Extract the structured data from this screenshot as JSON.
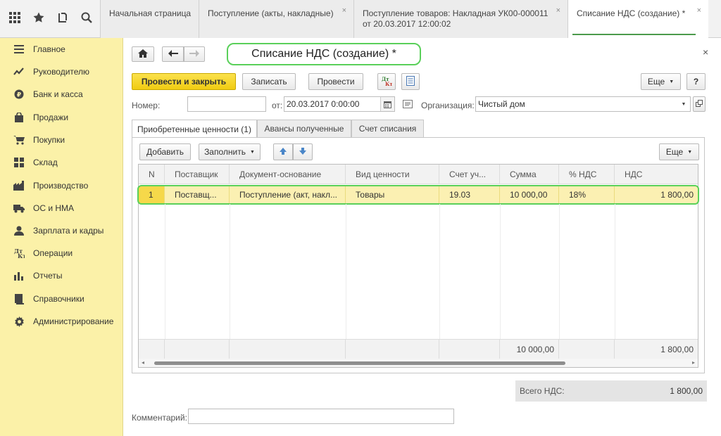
{
  "topbar": {
    "tabs": [
      {
        "label": "Начальная страница",
        "line2": ""
      },
      {
        "label": "Поступление (акты, накладные)",
        "line2": ""
      },
      {
        "label": "Поступление товаров: Накладная УК00-000011",
        "line2": "от 20.03.2017 12:00:02"
      },
      {
        "label": "Списание НДС (создание) *",
        "line2": ""
      }
    ],
    "close_glyph": "×"
  },
  "sidebar": {
    "items": [
      {
        "label": "Главное",
        "icon": "menu-lines-icon"
      },
      {
        "label": "Руководителю",
        "icon": "trend-icon"
      },
      {
        "label": "Банк и касса",
        "icon": "coin-icon"
      },
      {
        "label": "Продажи",
        "icon": "bag-icon"
      },
      {
        "label": "Покупки",
        "icon": "cart-icon"
      },
      {
        "label": "Склад",
        "icon": "warehouse-icon"
      },
      {
        "label": "Производство",
        "icon": "factory-icon"
      },
      {
        "label": "ОС и НМА",
        "icon": "truck-icon"
      },
      {
        "label": "Зарплата и кадры",
        "icon": "person-icon"
      },
      {
        "label": "Операции",
        "icon": "debit-credit-icon"
      },
      {
        "label": "Отчеты",
        "icon": "bar-chart-icon"
      },
      {
        "label": "Справочники",
        "icon": "book-icon"
      },
      {
        "label": "Администрирование",
        "icon": "gear-icon"
      }
    ]
  },
  "form": {
    "title": "Списание НДС (создание) *",
    "close_glyph": "×",
    "toolbar": {
      "post_and_close": "Провести и закрыть",
      "save": "Записать",
      "post": "Провести",
      "more": "Еще",
      "help": "?"
    },
    "fields": {
      "number_label": "Номер:",
      "number_value": "",
      "date_label": "от:",
      "date_value": "20.03.2017  0:00:00",
      "org_label": "Организация:",
      "org_value": "Чистый дом"
    },
    "tabs": [
      "Приобретенные ценности (1)",
      "Авансы полученные",
      "Счет списания"
    ],
    "table_toolbar": {
      "add": "Добавить",
      "fill": "Заполнить",
      "more": "Еще"
    },
    "table": {
      "columns": [
        "N",
        "Поставщик",
        "Документ-основание",
        "Вид ценности",
        "Счет уч...",
        "Сумма",
        "% НДС",
        "НДС"
      ],
      "rows": [
        [
          "1",
          "Поставщ...",
          "Поступление (акт, накл...",
          "Товары",
          "19.03",
          "10 000,00",
          "18%",
          "1 800,00"
        ]
      ],
      "totals": {
        "sum": "10 000,00",
        "vat": "1 800,00"
      }
    },
    "total_vat_label": "Всего НДС:",
    "total_vat_value": "1 800,00",
    "comment_label": "Комментарий:",
    "comment_value": ""
  },
  "colors": {
    "sidebar_bg": "#fbf1a8",
    "primary_button": "#f5d32a",
    "highlight": "#5ad05a",
    "selected_row": "#fbf0b2"
  }
}
